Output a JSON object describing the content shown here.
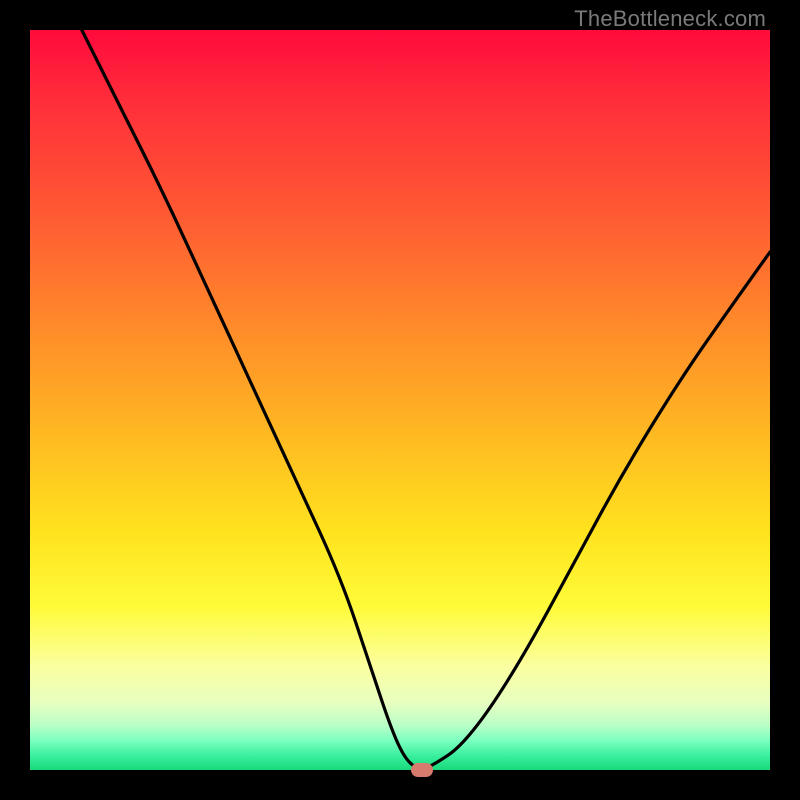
{
  "watermark": "TheBottleneck.com",
  "colors": {
    "curve_stroke": "#000000",
    "marker_fill": "#d77b6e",
    "frame_bg": "#000000"
  },
  "chart_data": {
    "type": "line",
    "title": "",
    "xlabel": "",
    "ylabel": "",
    "xlim": [
      0,
      100
    ],
    "ylim": [
      0,
      100
    ],
    "grid": false,
    "legend": false,
    "series": [
      {
        "name": "bottleneck-curve",
        "x": [
          7,
          12,
          18,
          24,
          30,
          36,
          42,
          46,
          49,
          51,
          53,
          55,
          58,
          62,
          67,
          73,
          80,
          88,
          95,
          100
        ],
        "y": [
          100,
          90,
          78,
          65,
          52,
          39,
          26,
          14,
          5,
          1,
          0,
          1,
          3,
          8,
          16,
          27,
          40,
          53,
          63,
          70
        ]
      }
    ],
    "marker": {
      "x": 53,
      "y": 0
    }
  }
}
